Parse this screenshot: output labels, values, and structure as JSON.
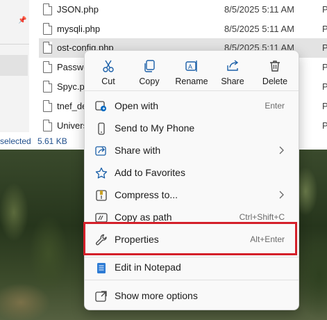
{
  "files": [
    {
      "name": "JSON.php",
      "date": "8/5/2025 5:11 AM",
      "type": "P",
      "selected": false
    },
    {
      "name": "mysqli.php",
      "date": "8/5/2025 5:11 AM",
      "type": "P",
      "selected": false
    },
    {
      "name": "ost-config.php",
      "date": "8/5/2025 5:11 AM",
      "type": "P",
      "selected": true
    },
    {
      "name": "Passwo",
      "date": "",
      "type": "P",
      "selected": false
    },
    {
      "name": "Spyc.ph",
      "date": "",
      "type": "P",
      "selected": false
    },
    {
      "name": "tnef_de",
      "date": "",
      "type": "P",
      "selected": false
    },
    {
      "name": "Univers",
      "date": "",
      "type": "P",
      "selected": false
    }
  ],
  "status_bar": {
    "selected": "selected",
    "size": "5.61 KB"
  },
  "quick_actions": [
    {
      "label": "Cut",
      "icon": "cut-icon"
    },
    {
      "label": "Copy",
      "icon": "copy-icon"
    },
    {
      "label": "Rename",
      "icon": "rename-icon"
    },
    {
      "label": "Share",
      "icon": "share-icon"
    },
    {
      "label": "Delete",
      "icon": "delete-icon"
    }
  ],
  "menu_items": [
    {
      "label": "Open with",
      "shortcut": "Enter",
      "icon": "open-with-icon"
    },
    {
      "label": "Send to My Phone",
      "shortcut": "",
      "icon": "phone-icon"
    },
    {
      "label": "Share with",
      "shortcut": "",
      "icon": "share-with-icon",
      "submenu": true
    },
    {
      "label": "Add to Favorites",
      "shortcut": "",
      "icon": "star-icon"
    },
    {
      "label": "Compress to...",
      "shortcut": "",
      "icon": "compress-icon",
      "submenu": true
    },
    {
      "label": "Copy as path",
      "shortcut": "Ctrl+Shift+C",
      "icon": "copy-path-icon"
    },
    {
      "label": "Properties",
      "shortcut": "Alt+Enter",
      "icon": "wrench-icon"
    },
    {
      "label": "Edit in Notepad",
      "shortcut": "",
      "icon": "notepad-icon"
    },
    {
      "label": "Show more options",
      "shortcut": "",
      "icon": "show-more-icon"
    }
  ],
  "colors": {
    "accent": "#0067c0",
    "highlight": "#d4202a",
    "menu_bg": "#f9f9f9"
  }
}
